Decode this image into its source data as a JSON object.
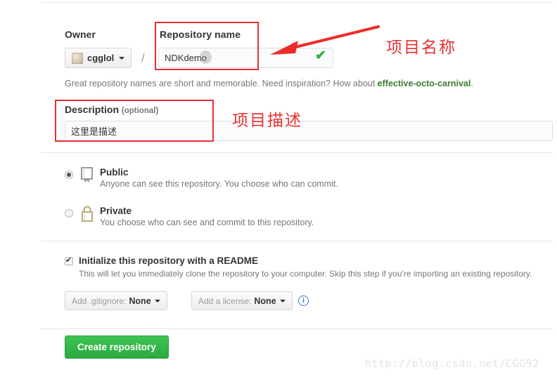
{
  "form": {
    "owner_label": "Owner",
    "owner_name": "cgglol",
    "separator": "/",
    "repo_label": "Repository name",
    "repo_value": "NDKdemo",
    "repo_placeholder": "",
    "repo_valid_icon": "check-icon",
    "hint_prefix": "Great repository names are short and memorable. Need inspiration? How about ",
    "hint_suggestion": "effective-octo-carnival",
    "hint_suffix": ".",
    "description_label": "Description",
    "description_optional": "(optional)",
    "description_value": "这里是描述",
    "description_placeholder": ""
  },
  "visibility": {
    "public": {
      "title": "Public",
      "desc": "Anyone can see this repository. You choose who can commit.",
      "selected": true,
      "icon": "repo-book-icon"
    },
    "private": {
      "title": "Private",
      "desc": "You choose who can see and commit to this repository.",
      "selected": false,
      "icon": "lock-icon"
    }
  },
  "readme": {
    "checked": true,
    "title": "Initialize this repository with a README",
    "desc": "This will let you immediately clone the repository to your computer. Skip this step if you're importing an existing repository.",
    "gitignore_prefix": "Add .gitignore: ",
    "gitignore_value": "None",
    "license_prefix": "Add a license: ",
    "license_value": "None",
    "info_icon": "info-icon",
    "info_glyph": "i"
  },
  "submit": {
    "create_label": "Create repository"
  },
  "annotations": {
    "repo_name_note": "项目名称",
    "description_note": "项目描述",
    "accent_color": "#e83030"
  },
  "watermark": {
    "text": "http://blog.csdn.net/CGG92"
  },
  "colors": {
    "green_button": "#2aa93f",
    "suggest_link": "#3a7b2e",
    "check_green": "#32b14a",
    "info_blue": "#3b7dd8",
    "annotation_red": "#e83030"
  }
}
